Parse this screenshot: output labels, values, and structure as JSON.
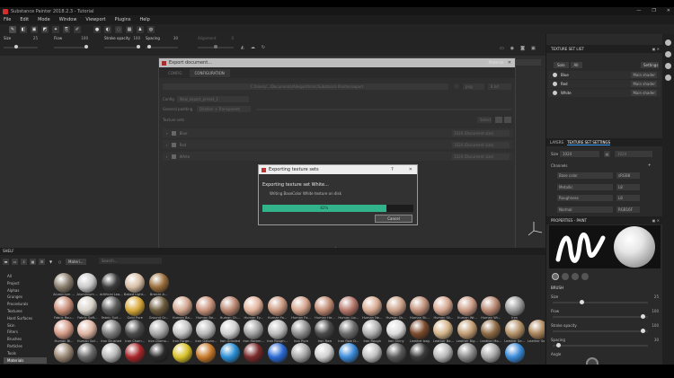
{
  "app": {
    "title": "Substance Painter 2018.2.3 - Tutorial"
  },
  "window_controls": [
    "—",
    "❐",
    "✕"
  ],
  "menu": [
    "File",
    "Edit",
    "Mode",
    "Window",
    "Viewport",
    "Plugins",
    "Help"
  ],
  "params": {
    "size": {
      "label": "Size",
      "value": "25"
    },
    "flow": {
      "label": "Flow",
      "value": "100"
    },
    "stroke_opacity": {
      "label": "Stroke opacity",
      "value": "100"
    },
    "spacing": {
      "label": "Spacing",
      "value": "30"
    },
    "alignment": {
      "label": "Alignment",
      "value": "0"
    }
  },
  "viewport": {
    "material_mode": "Material"
  },
  "export_dialog": {
    "title": "Export document...",
    "tabs": [
      "CONFIG",
      "CONFIGURATION"
    ],
    "output_path": "C:/Users/.../Documents/Allegorithmic/Substance Painter/export",
    "config_label": "Config",
    "config_value": "New_export_preset_1",
    "padding_label": "General padding",
    "padding_value": "Dilation + Transparent",
    "format_value": "png",
    "bitdepth_value": "8 bit",
    "texture_sets_label": "Texture sets",
    "select_label": "Select",
    "texture_sets": [
      {
        "name": "Blue",
        "res": "1024 (Document size)"
      },
      {
        "name": "Red",
        "res": "1024 (Document size)"
      },
      {
        "name": "White",
        "res": "1024 (Document size)"
      }
    ],
    "footer_note": "Export shaders parameters",
    "open_label": "Open export folder after export",
    "cancel_label": "Cancel",
    "export_label": "Export"
  },
  "progress_dialog": {
    "title": "Exporting texture sets",
    "help_glyph": "?",
    "heading": "Exporting texture set White...",
    "status": "Writing BaseColor White texture on disk",
    "percent": 0.82,
    "percent_label": "82%",
    "cancel_label": "Cancel"
  },
  "shelf": {
    "title": "SHELF",
    "filter_label": "Materi...",
    "search_placeholder": "Search...",
    "categories": [
      "All",
      "Project",
      "Alphas",
      "Grunges",
      "Procedurals",
      "Textures",
      "Hard Surfaces",
      "Skin",
      "Filters",
      "Brushes",
      "Particles",
      "Tools",
      "Materials",
      "Smart materials"
    ],
    "selected_category": "Materials",
    "rows": [
      [
        {
          "label": "Aluminium ...",
          "color": "#8a7d6d"
        },
        {
          "label": "Aluminium ...",
          "color": "#c9c9c9"
        },
        {
          "label": "Artificial Lea...",
          "color": "#3a3a3a"
        },
        {
          "label": "Baked Light...",
          "color": "#d8bfa6"
        },
        {
          "label": "Bronze A...",
          "color": "#9a6e3a"
        }
      ],
      [
        {
          "label": "Fabric Rou...",
          "color": "#c98f79"
        },
        {
          "label": "Fabric Soft...",
          "color": "#d9d3c9"
        },
        {
          "label": "Fabric Suit...",
          "color": "#5b5b5b"
        },
        {
          "label": "Gold Pure",
          "color": "#d8a93a"
        },
        {
          "label": "Ground Gr...",
          "color": "#6b5a3c"
        },
        {
          "label": "Human Ba...",
          "color": "#d3a78f"
        },
        {
          "label": "Human Be...",
          "color": "#c8917a"
        },
        {
          "label": "Human Ch...",
          "color": "#b88570"
        },
        {
          "label": "Human Ey...",
          "color": "#e2b39b"
        },
        {
          "label": "Human Fa...",
          "color": "#c9977f"
        },
        {
          "label": "Human Fo...",
          "color": "#d4a48c"
        },
        {
          "label": "Human He...",
          "color": "#c08a72"
        },
        {
          "label": "Human Lip...",
          "color": "#b5766a"
        },
        {
          "label": "Human Ne...",
          "color": "#d8ab93"
        },
        {
          "label": "Human Sh...",
          "color": "#caa088"
        },
        {
          "label": "Human Sk...",
          "color": "#bf8f79"
        },
        {
          "label": "Human Sk...",
          "color": "#d6a790"
        },
        {
          "label": "Human Wr...",
          "color": "#c99a84"
        },
        {
          "label": "Human Wr...",
          "color": "#b88772"
        },
        {
          "label": "Iron",
          "color": "#9a9a9a"
        }
      ],
      [
        {
          "label": "Human Bl...",
          "color": "#d49a86"
        },
        {
          "label": "Human Sof...",
          "color": "#e0b6a4"
        },
        {
          "label": "Iron Brushed",
          "color": "#7d7d7d"
        },
        {
          "label": "Iron Chain...",
          "color": "#4b4b4b"
        },
        {
          "label": "Iron Diamo...",
          "color": "#a8a8a8"
        },
        {
          "label": "Iron Forge...",
          "color": "#c4c4c4"
        },
        {
          "label": "Iron Galvan...",
          "color": "#b8b8b8"
        },
        {
          "label": "Iron Grinded",
          "color": "#cfcfcf"
        },
        {
          "label": "Iron Hamm...",
          "color": "#a2a2a2"
        },
        {
          "label": "Iron Rough...",
          "color": "#bdbdbd"
        },
        {
          "label": "Iron Pure",
          "color": "#8f8f8f"
        },
        {
          "label": "Iron Raw",
          "color": "#4a4a4a"
        },
        {
          "label": "Iron Raw D...",
          "color": "#6c6c6c"
        },
        {
          "label": "Iron Rough",
          "color": "#b1b1b1"
        },
        {
          "label": "Iron Shiny",
          "color": "#dcdcdc"
        },
        {
          "label": "Leather bag",
          "color": "#7b4a2b"
        },
        {
          "label": "Leather Ba...",
          "color": "#d4b489"
        },
        {
          "label": "Leather Big...",
          "color": "#c29d73"
        },
        {
          "label": "Leather Ma...",
          "color": "#8e6a44"
        },
        {
          "label": "Leather Se...",
          "color": "#b39167"
        },
        {
          "label": "Leather Sof...",
          "color": "#a98359"
        }
      ],
      [
        {
          "label": "",
          "color": "#9a8774"
        },
        {
          "label": "",
          "color": "#6a6a6a"
        },
        {
          "label": "",
          "color": "#b8b8b8"
        },
        {
          "label": "",
          "color": "#a8262a"
        },
        {
          "label": "",
          "color": "#2a2a2a"
        },
        {
          "label": "",
          "color": "#d8c12a"
        },
        {
          "label": "",
          "color": "#c87a2a"
        },
        {
          "label": "",
          "color": "#2a8ed4"
        },
        {
          "label": "",
          "color": "#7a2a2a"
        },
        {
          "label": "",
          "color": "#2a6ad4"
        },
        {
          "label": "",
          "color": "#a8a8a8"
        },
        {
          "label": "",
          "color": "#d0d0d0"
        },
        {
          "label": "",
          "color": "#3a8ad8"
        },
        {
          "label": "",
          "color": "#c0c0c0"
        },
        {
          "label": "",
          "color": "#5a5a5a"
        },
        {
          "label": "",
          "color": "#3a3a3a"
        },
        {
          "label": "",
          "color": "#b8b8b8"
        },
        {
          "label": "",
          "color": "#8a8a8a"
        },
        {
          "label": "",
          "color": "#a8a8a8"
        },
        {
          "label": "",
          "color": "#3a8ad8"
        }
      ]
    ]
  },
  "texture_set_list": {
    "title": "TEXTURE SET LIST",
    "solo_label": "Solo",
    "all_label": "All",
    "settings_label": "Settings",
    "items": [
      {
        "name": "Blue",
        "shader": "Main shader"
      },
      {
        "name": "Red",
        "shader": "Main shader"
      },
      {
        "name": "White",
        "shader": "Main shader"
      }
    ]
  },
  "texture_set_settings": {
    "tabs": [
      "LAYERS",
      "TEXTURE SET SETTINGS"
    ],
    "size_label": "Size",
    "size_value": "1024",
    "size_right": "1024",
    "channels_label": "Channels",
    "channels": [
      {
        "name": "Base color",
        "format": "sRGB8"
      },
      {
        "name": "Metallic",
        "format": "L8"
      },
      {
        "name": "Roughness",
        "format": "L8"
      },
      {
        "name": "Normal",
        "format": "RGB16F"
      }
    ]
  },
  "properties": {
    "title": "PROPERTIES - PAINT",
    "section_label": "BRUSH",
    "size": {
      "label": "Size",
      "value": "25"
    },
    "flow": {
      "label": "Flow",
      "value": "100"
    },
    "stroke_opacity": {
      "label": "Stroke opacity",
      "value": "100"
    },
    "spacing": {
      "label": "Spacing",
      "value": "30"
    },
    "angle_label": "Angle"
  }
}
